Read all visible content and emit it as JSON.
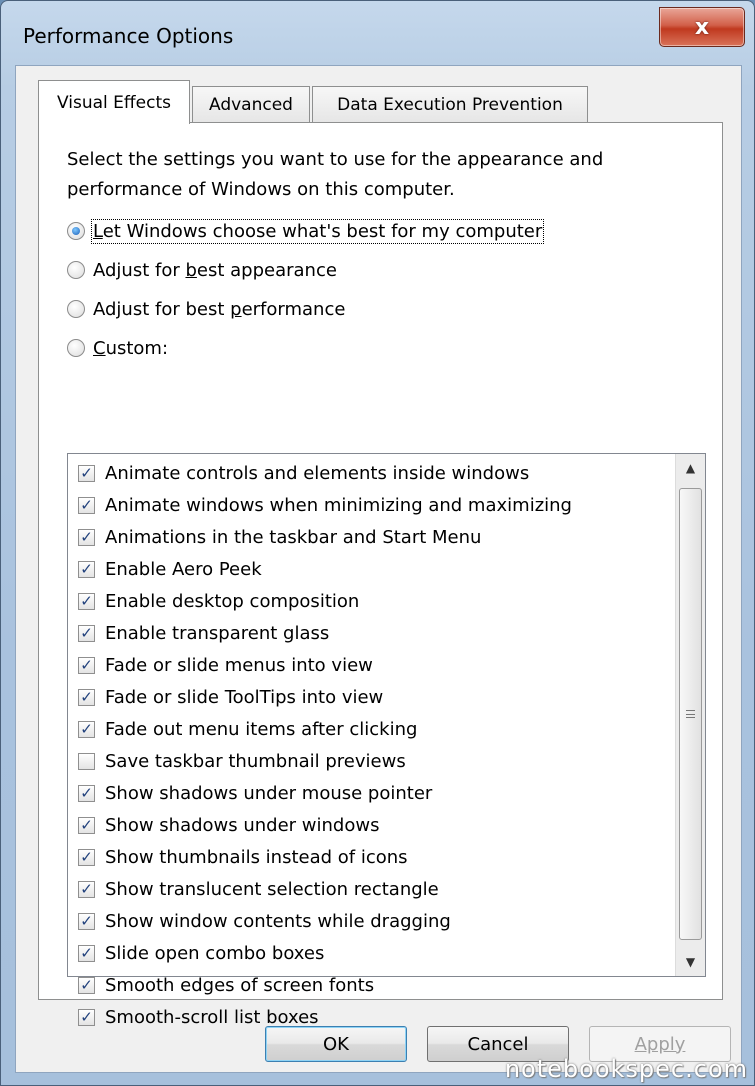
{
  "window": {
    "title": "Performance Options",
    "close_label": "x"
  },
  "tabs": [
    {
      "label": "Visual Effects",
      "active": true
    },
    {
      "label": "Advanced",
      "active": false
    },
    {
      "label": "Data Execution Prevention",
      "active": false
    }
  ],
  "visual_effects": {
    "description": "Select the settings you want to use for the appearance and performance of Windows on this computer.",
    "radios": [
      {
        "pre": "",
        "u": "L",
        "post": "et Windows choose what's best for my computer",
        "checked": true
      },
      {
        "pre": "Adjust for ",
        "u": "b",
        "post": "est appearance",
        "checked": false
      },
      {
        "pre": "Adjust for best ",
        "u": "p",
        "post": "erformance",
        "checked": false
      },
      {
        "pre": "",
        "u": "C",
        "post": "ustom:",
        "checked": false
      }
    ],
    "effects": [
      {
        "label": "Animate controls and elements inside windows",
        "checked": true
      },
      {
        "label": "Animate windows when minimizing and maximizing",
        "checked": true
      },
      {
        "label": "Animations in the taskbar and Start Menu",
        "checked": true
      },
      {
        "label": "Enable Aero Peek",
        "checked": true
      },
      {
        "label": "Enable desktop composition",
        "checked": true
      },
      {
        "label": "Enable transparent glass",
        "checked": true
      },
      {
        "label": "Fade or slide menus into view",
        "checked": true
      },
      {
        "label": "Fade or slide ToolTips into view",
        "checked": true
      },
      {
        "label": "Fade out menu items after clicking",
        "checked": true
      },
      {
        "label": "Save taskbar thumbnail previews",
        "checked": false
      },
      {
        "label": "Show shadows under mouse pointer",
        "checked": true
      },
      {
        "label": "Show shadows under windows",
        "checked": true
      },
      {
        "label": "Show thumbnails instead of icons",
        "checked": true
      },
      {
        "label": "Show translucent selection rectangle",
        "checked": true
      },
      {
        "label": "Show window contents while dragging",
        "checked": true
      },
      {
        "label": "Slide open combo boxes",
        "checked": true
      },
      {
        "label": "Smooth edges of screen fonts",
        "checked": true
      },
      {
        "label": "Smooth-scroll list boxes",
        "checked": true
      }
    ]
  },
  "buttons": {
    "ok": "OK",
    "cancel": "Cancel",
    "apply": "Apply"
  },
  "watermark": "notebookspec.com",
  "icons": {
    "scroll_up": "triangle-up-icon",
    "scroll_down": "triangle-down-icon",
    "checkmark": "checkmark-icon"
  }
}
